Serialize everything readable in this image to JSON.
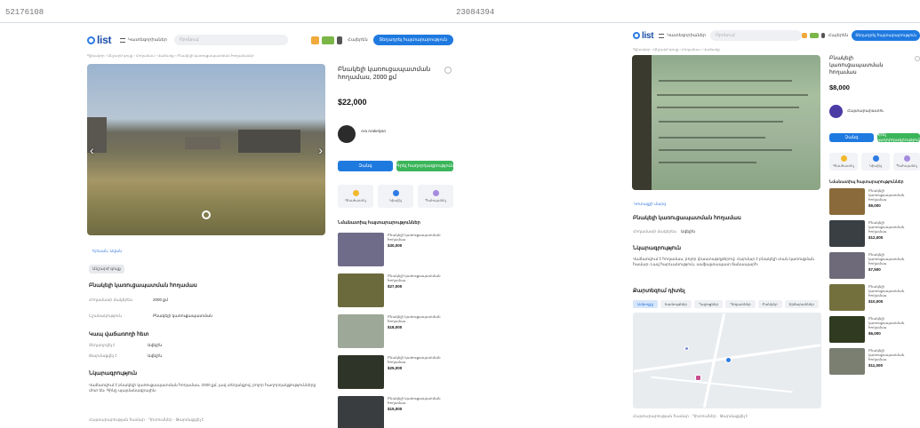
{
  "left": {
    "id_label": "52176108",
    "header": {
      "logo": "list",
      "categories": "Կատեգորիաներ",
      "search_placeholder": "Որոնում",
      "lang": "Հայերեն",
      "post_button": "Տեղադրել հայտարարություն"
    },
    "breadcrumb": "Գլխավոր  ›  Անշարժ գույք  ›  Հողամաս  ›  Վաճառք  ›  Բնակելի կառուցապատման հողամասեր",
    "listing": {
      "title": "Բնակելի կառուցապատման հողամաս, 2000 քմ",
      "price": "$22,000",
      "seller": "Ara Arakelyan",
      "call": "Զանգ",
      "message": "Գրել հաղորդագրություն",
      "actions": [
        "Գնահատել",
        "Կիսվել",
        "Պահպանել"
      ]
    },
    "location_link": "Երևան, Ավան",
    "badge": "Անշարժ գույք",
    "section_title": "Բնակելի կառուցապատման հողամաս",
    "details": [
      {
        "label": "Հողամասի մակերես",
        "value": "2000 քմ"
      },
      {
        "label": "Նշանակություն",
        "value": "Բնակելի կառուցապատման"
      }
    ],
    "contact_title": "Կապ վաճառողի հետ",
    "meta": [
      {
        "label": "Տեղադրվել է",
        "value": "Ավելին"
      },
      {
        "label": "Թարմացվել է",
        "value": "Ավելին"
      }
    ],
    "desc_title": "Նկարագրություն",
    "desc": "Վաճառվում է բնակելի կառուցապատման հողամաս, 2000 քմ, լավ տեղանքով, բոլոր հաղորդակցությունները մոտ են։ Գինը պայմանագրային։",
    "similar_title": "Նմանատիպ հայտարարություններ",
    "similar": [
      {
        "text": "Բնակելի կառուցապատման հողամաս",
        "price": "$30,000",
        "color": "#6f6c8a"
      },
      {
        "text": "Բնակելի կառուցապատման հողամաս",
        "price": "$27,000",
        "color": "#6b6a3c"
      },
      {
        "text": "Բնակելի կառուցապատման հողամաս",
        "price": "$18,000",
        "color": "#9ea898"
      },
      {
        "text": "Բնակելի կառուցապատման հողամաս",
        "price": "$25,000",
        "color": "#2f3428"
      },
      {
        "text": "Բնակելի կառուցապատման հողամաս",
        "price": "$15,000",
        "color": "#3a3d40"
      }
    ],
    "footer": "Հայտարարության համար  ·  Դիտումներ  ·  Թարմացվել է"
  },
  "right": {
    "id_label": "23084394",
    "header": {
      "logo": "list",
      "categories": "Կատեգորիաներ",
      "search_placeholder": "Որոնում",
      "lang": "Հայերեն",
      "post_button": "Տեղադրել հայտարարություն"
    },
    "breadcrumb": "Գլխավոր  ›  Անշարժ գույք  ›  Հողամաս  ›  Վաճառք",
    "listing": {
      "title": "Բնակելի կառուցապատման հողամաս",
      "price": "$8,000",
      "seller": "Հայտարարատու",
      "call": "Զանգ",
      "message": "Գրել հաղորդագրություն",
      "actions": [
        "Գնահատել",
        "Կիսվել",
        "Պահպանել"
      ]
    },
    "location_link": "Կոտայքի մարզ",
    "section_title": "Բնակելի կառուցապատման հողամաս",
    "details": [
      {
        "label": "Հողամասի մակերես",
        "value": "Ավելին"
      }
    ],
    "desc_title": "Նկարագրություն",
    "desc": "Վաճառվում է հողամաս, բոլոր փաստաթղթերով։ Հարմար է բնակելի տան կառուցման համար։ Լավ հարևանություն, ասֆալտապատ ճանապարհ։",
    "map_title": "Քարտեզում դիտել",
    "map_tabs": [
      "Ամբողջը",
      "Խանութներ",
      "Դպրոցներ",
      "Դեղատներ",
      "Բանկեր",
      "Սրճարաններ"
    ],
    "similar_title": "Նմանատիպ հայտարարություններ",
    "similar": [
      {
        "text": "Բնակելի կառուցապատման հողամաս",
        "price": "$9,000",
        "color": "#8a6a3a"
      },
      {
        "text": "Բնակելի կառուցապատման հողամաս",
        "price": "$12,000",
        "color": "#3a3f44"
      },
      {
        "text": "Բնակելի կառուցապատման հողամաս",
        "price": "$7,500",
        "color": "#6e6a7a"
      },
      {
        "text": "Բնակելի կառուցապատման հողամաս",
        "price": "$10,000",
        "color": "#74703e"
      },
      {
        "text": "Բնակելի կառուցապատման հողամաս",
        "price": "$6,000",
        "color": "#2f3a20"
      },
      {
        "text": "Բնակելի կառուցապատման հողամաս",
        "price": "$11,000",
        "color": "#7b7f72"
      }
    ],
    "footer": "Հայտարարության համար  ·  Դիտումներ  ·  Թարմացվել է"
  }
}
